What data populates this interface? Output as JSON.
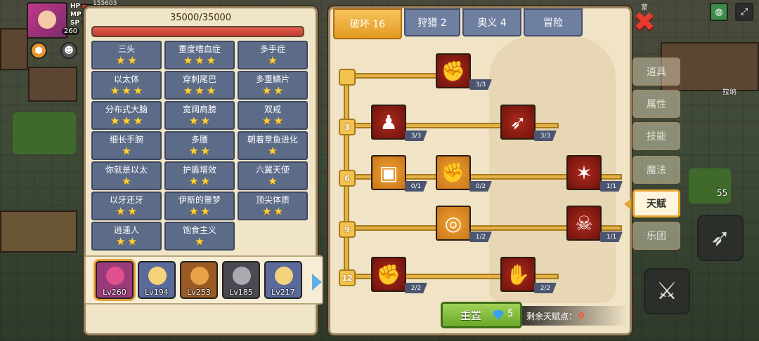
{
  "hud": {
    "level": "260",
    "top_number": "155603",
    "bars": [
      {
        "label": "HP",
        "color": "#d93a2f"
      },
      {
        "label": "MP",
        "color": "#3a7ae0"
      },
      {
        "label": "SP",
        "color": "#e8c33a"
      }
    ]
  },
  "hero_panel": {
    "hp_text": "35000/35000",
    "hp_fraction": 1.0,
    "traits": [
      {
        "name": "三头",
        "stars": 2
      },
      {
        "name": "重度嗜血症",
        "stars": 3
      },
      {
        "name": "多手症",
        "stars": 1
      },
      {
        "name": "以太体",
        "stars": 3
      },
      {
        "name": "穿刺尾巴",
        "stars": 3
      },
      {
        "name": "多重鳞片",
        "stars": 2
      },
      {
        "name": "分布式大脑",
        "stars": 3
      },
      {
        "name": "宽阔肩膀",
        "stars": 2
      },
      {
        "name": "双戒",
        "stars": 2
      },
      {
        "name": "细长手腕",
        "stars": 1
      },
      {
        "name": "多腰",
        "stars": 2
      },
      {
        "name": "朝着章鱼进化",
        "stars": 1
      },
      {
        "name": "你就是以太",
        "stars": 1
      },
      {
        "name": "护盾增效",
        "stars": 2
      },
      {
        "name": "六翼天使",
        "stars": 1
      },
      {
        "name": "以牙还牙",
        "stars": 2
      },
      {
        "name": "伊斯的噩梦",
        "stars": 2
      },
      {
        "name": "顶尖体质",
        "stars": 2
      },
      {
        "name": "逍遥人",
        "stars": 2
      },
      {
        "name": "饱食主义",
        "stars": 1
      }
    ],
    "heroes": [
      {
        "level": "Lv260",
        "bg": "#9a3a7a",
        "head": "#e0508f",
        "selected": true
      },
      {
        "level": "Lv194",
        "bg": "#5a6a9a",
        "head": "#f2d27a",
        "selected": false
      },
      {
        "level": "Lv253",
        "bg": "#9a5a24",
        "head": "#e9a24a",
        "selected": false
      },
      {
        "level": "Lv185",
        "bg": "#4a4a52",
        "head": "#a9a9b0",
        "selected": false
      },
      {
        "level": "Lv217",
        "bg": "#5a6a9a",
        "head": "#f2d27a",
        "selected": false
      }
    ]
  },
  "talent_panel": {
    "tabs": [
      {
        "label": "破坏 16",
        "active": true
      },
      {
        "label": "狩猎 2",
        "active": false
      },
      {
        "label": "奥义 4",
        "active": false
      },
      {
        "label": "冒险",
        "active": false
      }
    ],
    "tiers": [
      "",
      "3",
      "6",
      "9",
      "12"
    ],
    "skills": [
      {
        "icon": "arm-wrestle-icon",
        "glyph": "✊",
        "count": "3/3",
        "style": "red"
      },
      {
        "icon": "body-icon",
        "glyph": "♟",
        "count": "3/3",
        "style": "red"
      },
      {
        "icon": "arrow-hit-icon",
        "glyph": "➶",
        "count": "3/3",
        "style": "red"
      },
      {
        "icon": "card-icon",
        "glyph": "▣",
        "count": "0/1",
        "style": "orange"
      },
      {
        "icon": "punch-icon",
        "glyph": "✊",
        "count": "0/2",
        "style": "orange"
      },
      {
        "icon": "blood-splash-icon",
        "glyph": "✶",
        "count": "1/1",
        "style": "red"
      },
      {
        "icon": "ripple-icon",
        "glyph": "◎",
        "count": "1/2",
        "style": "orange"
      },
      {
        "icon": "demon-icon",
        "glyph": "☠",
        "count": "1/1",
        "style": "red"
      },
      {
        "icon": "fist-icon",
        "glyph": "✊",
        "count": "2/2",
        "style": "red"
      },
      {
        "icon": "grab-icon",
        "glyph": "✋",
        "count": "2/2",
        "style": "red"
      }
    ],
    "reset_label": "重置",
    "gem_count": "5",
    "points_label": "剩余天赋点：",
    "points_value": "0"
  },
  "side_menu": [
    {
      "label": "道具",
      "active": false
    },
    {
      "label": "属性",
      "active": false
    },
    {
      "label": "技能",
      "active": false
    },
    {
      "label": "魔法",
      "active": false
    },
    {
      "label": "天赋",
      "active": true
    },
    {
      "label": "乐团",
      "active": false
    }
  ],
  "map": {
    "location_label": "拉纳",
    "counter": "55",
    "top_text": "蒙"
  }
}
